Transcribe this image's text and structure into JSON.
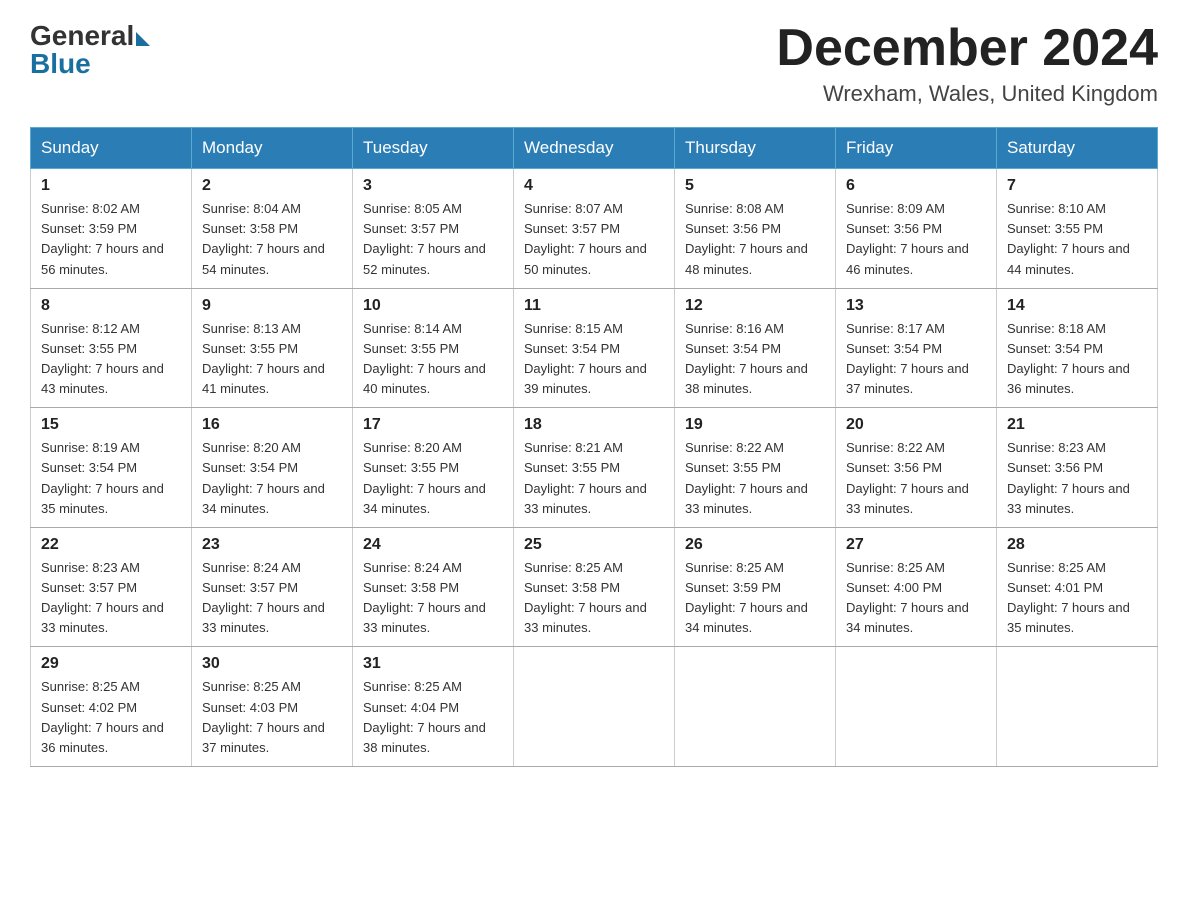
{
  "header": {
    "logo_general": "General",
    "logo_blue": "Blue",
    "month_title": "December 2024",
    "location": "Wrexham, Wales, United Kingdom"
  },
  "days_of_week": [
    "Sunday",
    "Monday",
    "Tuesday",
    "Wednesday",
    "Thursday",
    "Friday",
    "Saturday"
  ],
  "weeks": [
    [
      {
        "day": "1",
        "sunrise": "8:02 AM",
        "sunset": "3:59 PM",
        "daylight": "7 hours and 56 minutes."
      },
      {
        "day": "2",
        "sunrise": "8:04 AM",
        "sunset": "3:58 PM",
        "daylight": "7 hours and 54 minutes."
      },
      {
        "day": "3",
        "sunrise": "8:05 AM",
        "sunset": "3:57 PM",
        "daylight": "7 hours and 52 minutes."
      },
      {
        "day": "4",
        "sunrise": "8:07 AM",
        "sunset": "3:57 PM",
        "daylight": "7 hours and 50 minutes."
      },
      {
        "day": "5",
        "sunrise": "8:08 AM",
        "sunset": "3:56 PM",
        "daylight": "7 hours and 48 minutes."
      },
      {
        "day": "6",
        "sunrise": "8:09 AM",
        "sunset": "3:56 PM",
        "daylight": "7 hours and 46 minutes."
      },
      {
        "day": "7",
        "sunrise": "8:10 AM",
        "sunset": "3:55 PM",
        "daylight": "7 hours and 44 minutes."
      }
    ],
    [
      {
        "day": "8",
        "sunrise": "8:12 AM",
        "sunset": "3:55 PM",
        "daylight": "7 hours and 43 minutes."
      },
      {
        "day": "9",
        "sunrise": "8:13 AM",
        "sunset": "3:55 PM",
        "daylight": "7 hours and 41 minutes."
      },
      {
        "day": "10",
        "sunrise": "8:14 AM",
        "sunset": "3:55 PM",
        "daylight": "7 hours and 40 minutes."
      },
      {
        "day": "11",
        "sunrise": "8:15 AM",
        "sunset": "3:54 PM",
        "daylight": "7 hours and 39 minutes."
      },
      {
        "day": "12",
        "sunrise": "8:16 AM",
        "sunset": "3:54 PM",
        "daylight": "7 hours and 38 minutes."
      },
      {
        "day": "13",
        "sunrise": "8:17 AM",
        "sunset": "3:54 PM",
        "daylight": "7 hours and 37 minutes."
      },
      {
        "day": "14",
        "sunrise": "8:18 AM",
        "sunset": "3:54 PM",
        "daylight": "7 hours and 36 minutes."
      }
    ],
    [
      {
        "day": "15",
        "sunrise": "8:19 AM",
        "sunset": "3:54 PM",
        "daylight": "7 hours and 35 minutes."
      },
      {
        "day": "16",
        "sunrise": "8:20 AM",
        "sunset": "3:54 PM",
        "daylight": "7 hours and 34 minutes."
      },
      {
        "day": "17",
        "sunrise": "8:20 AM",
        "sunset": "3:55 PM",
        "daylight": "7 hours and 34 minutes."
      },
      {
        "day": "18",
        "sunrise": "8:21 AM",
        "sunset": "3:55 PM",
        "daylight": "7 hours and 33 minutes."
      },
      {
        "day": "19",
        "sunrise": "8:22 AM",
        "sunset": "3:55 PM",
        "daylight": "7 hours and 33 minutes."
      },
      {
        "day": "20",
        "sunrise": "8:22 AM",
        "sunset": "3:56 PM",
        "daylight": "7 hours and 33 minutes."
      },
      {
        "day": "21",
        "sunrise": "8:23 AM",
        "sunset": "3:56 PM",
        "daylight": "7 hours and 33 minutes."
      }
    ],
    [
      {
        "day": "22",
        "sunrise": "8:23 AM",
        "sunset": "3:57 PM",
        "daylight": "7 hours and 33 minutes."
      },
      {
        "day": "23",
        "sunrise": "8:24 AM",
        "sunset": "3:57 PM",
        "daylight": "7 hours and 33 minutes."
      },
      {
        "day": "24",
        "sunrise": "8:24 AM",
        "sunset": "3:58 PM",
        "daylight": "7 hours and 33 minutes."
      },
      {
        "day": "25",
        "sunrise": "8:25 AM",
        "sunset": "3:58 PM",
        "daylight": "7 hours and 33 minutes."
      },
      {
        "day": "26",
        "sunrise": "8:25 AM",
        "sunset": "3:59 PM",
        "daylight": "7 hours and 34 minutes."
      },
      {
        "day": "27",
        "sunrise": "8:25 AM",
        "sunset": "4:00 PM",
        "daylight": "7 hours and 34 minutes."
      },
      {
        "day": "28",
        "sunrise": "8:25 AM",
        "sunset": "4:01 PM",
        "daylight": "7 hours and 35 minutes."
      }
    ],
    [
      {
        "day": "29",
        "sunrise": "8:25 AM",
        "sunset": "4:02 PM",
        "daylight": "7 hours and 36 minutes."
      },
      {
        "day": "30",
        "sunrise": "8:25 AM",
        "sunset": "4:03 PM",
        "daylight": "7 hours and 37 minutes."
      },
      {
        "day": "31",
        "sunrise": "8:25 AM",
        "sunset": "4:04 PM",
        "daylight": "7 hours and 38 minutes."
      },
      null,
      null,
      null,
      null
    ]
  ]
}
